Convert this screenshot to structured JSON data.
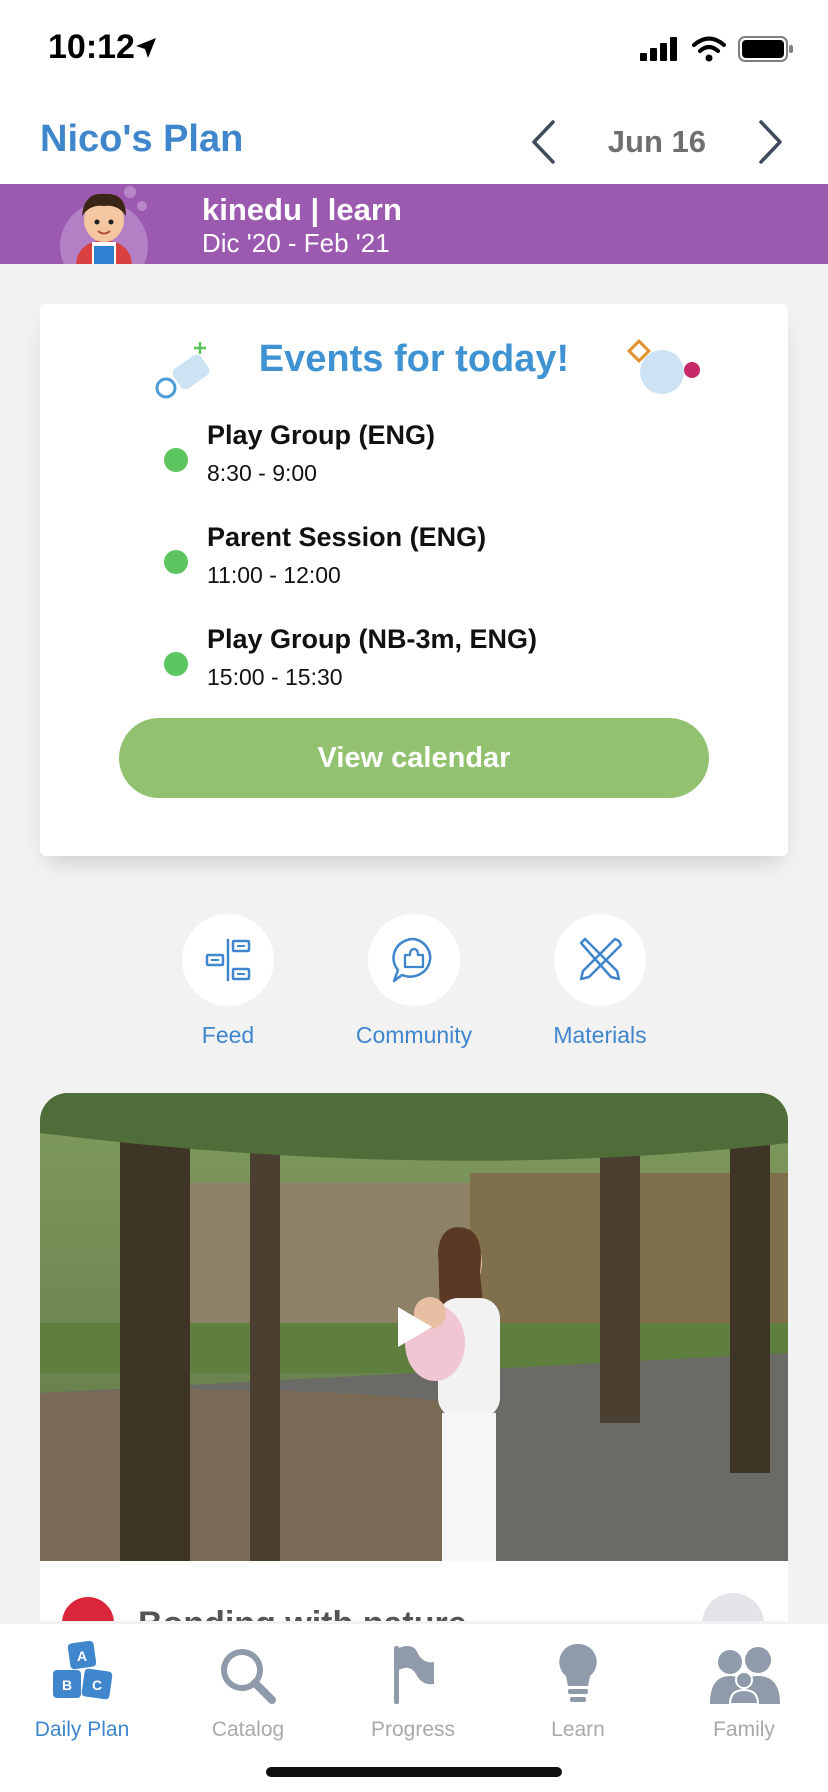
{
  "status_bar": {
    "time": "10:12"
  },
  "header": {
    "plan_title": "Nico's Plan",
    "date": "Jun 16"
  },
  "banner": {
    "title": "kinedu | learn",
    "subtitle": "Dic '20 - Feb '21",
    "color": "#9b59b0"
  },
  "events": {
    "title": "Events for today!",
    "items": [
      {
        "name": "Play Group (ENG)",
        "time": "8:30 - 9:00"
      },
      {
        "name": "Parent Session (ENG)",
        "time": "11:00 - 12:00"
      },
      {
        "name": "Play Group (NB-3m, ENG)",
        "time": "15:00 - 15:30"
      }
    ],
    "button_label": "View calendar"
  },
  "quick_links": [
    {
      "label": "Feed",
      "icon": "feed-icon"
    },
    {
      "label": "Community",
      "icon": "community-icon"
    },
    {
      "label": "Materials",
      "icon": "materials-icon"
    }
  ],
  "activity": {
    "title": "Bonding with nature"
  },
  "tabs": [
    {
      "label": "Daily Plan",
      "icon": "abc-blocks-icon",
      "active": true
    },
    {
      "label": "Catalog",
      "icon": "search-icon",
      "active": false
    },
    {
      "label": "Progress",
      "icon": "flag-icon",
      "active": false
    },
    {
      "label": "Learn",
      "icon": "lightbulb-icon",
      "active": false
    },
    {
      "label": "Family",
      "icon": "family-icon",
      "active": false
    }
  ],
  "colors": {
    "accent_blue": "#3f86cc",
    "event_dot_green": "#5cc55f",
    "button_green": "#92c26f",
    "inactive_gray": "#a9a9a9"
  }
}
